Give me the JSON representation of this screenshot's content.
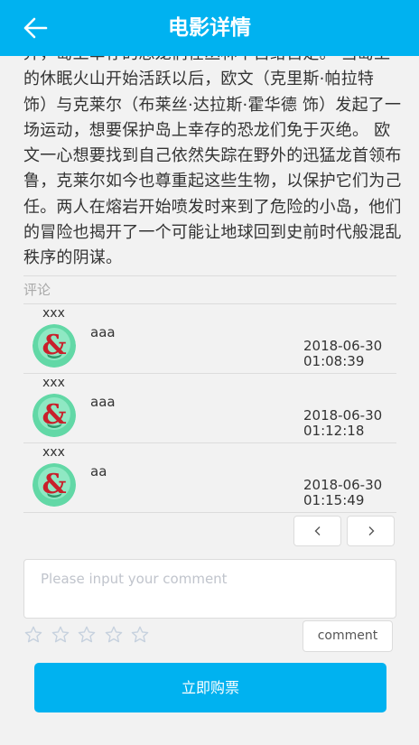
{
  "header": {
    "title": "电影详情"
  },
  "synopsis": {
    "text": "弃，岛上幸存的恐龙们在丛林中自给自足。 当岛上的休眠火山开始活跃以后，欧文（克里斯·帕拉特 饰）与克莱尔（布莱丝·达拉斯·霍华德 饰）发起了一场运动，想要保护岛上幸存的恐龙们免于灭绝。 欧文一心想要找到自己依然失踪在野外的迅猛龙首领布鲁，克莱尔如今也尊重起这些生物，以保护它们为己任。两人在熔岩开始喷发时来到了危险的小岛，他们的冒险也揭开了一个可能让地球回到史前时代般混乱秩序的阴谋。"
  },
  "comments_section": {
    "label": "评论",
    "items": [
      {
        "user": "xxx",
        "text": "aaa",
        "date": "2018-06-30",
        "time": "01:08:39"
      },
      {
        "user": "xxx",
        "text": "aaa",
        "date": "2018-06-30",
        "time": "01:12:18"
      },
      {
        "user": "xxx",
        "text": "aa",
        "date": "2018-06-30",
        "time": "01:15:49"
      }
    ]
  },
  "pagination": {
    "prev_icon": "chevron-left-icon",
    "next_icon": "chevron-right-icon"
  },
  "comment_form": {
    "placeholder": "Please input your comment",
    "value": "",
    "rating": {
      "value": 0,
      "max": 5
    },
    "submit_label": "comment"
  },
  "buy": {
    "label": "立即购票"
  },
  "colors": {
    "accent": "#00b2f0",
    "border": "#dcdcdc",
    "background": "#f2f2f2",
    "star_outline": "#c6d1de"
  }
}
